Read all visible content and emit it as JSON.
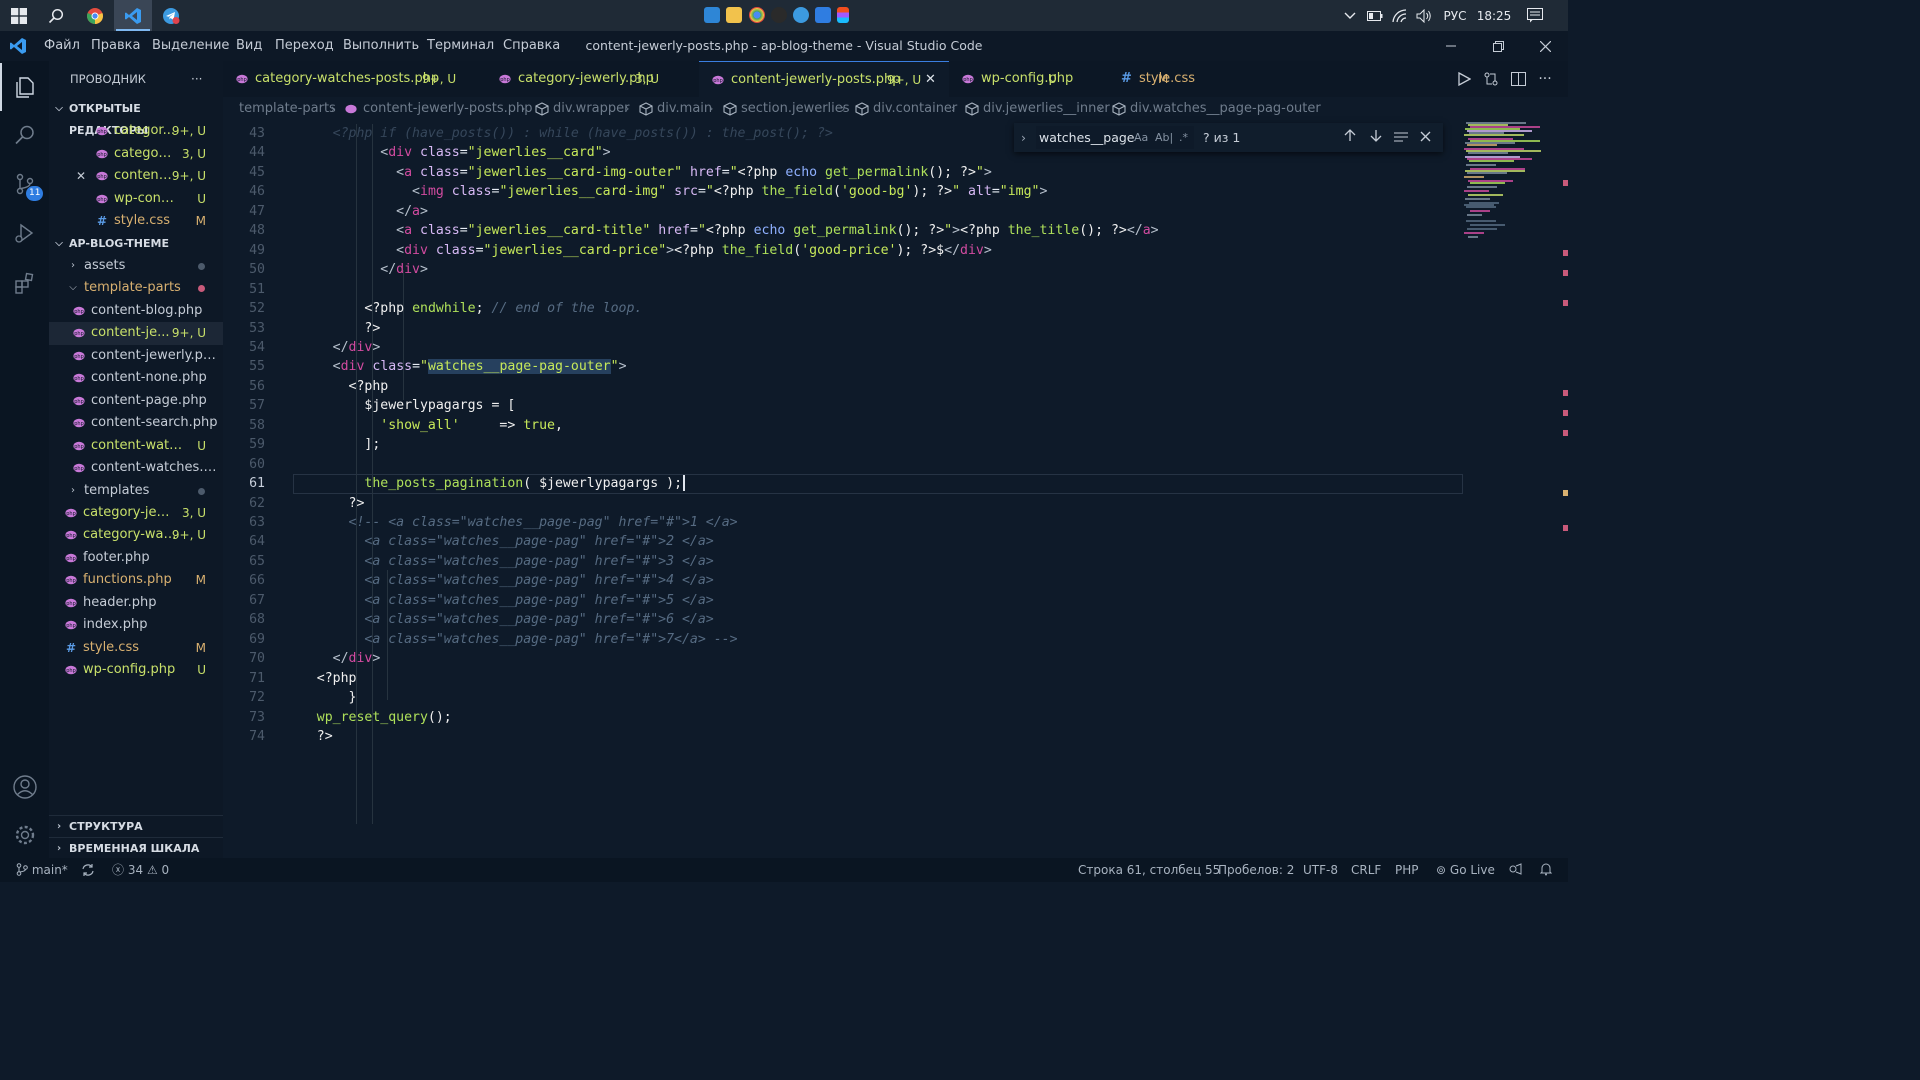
{
  "taskbar": {
    "lang": "РУС",
    "clock": "18:25"
  },
  "titlebar": {
    "menu": [
      "Файл",
      "Правка",
      "Выделение",
      "Вид",
      "Переход",
      "Выполнить",
      "Терминал",
      "Справка"
    ],
    "title": "content-jewerly-posts.php - ap-blog-theme - Visual Studio Code"
  },
  "activity": {
    "scm_badge": "11"
  },
  "sidebar": {
    "header": "ПРОВОДНИК",
    "more": "···",
    "open_editors_title": "ОТКРЫТЫЕ РЕДАКТОРЫ",
    "open_editors": [
      {
        "name": "categor...",
        "badge": "9+, U",
        "type": "php",
        "close": ""
      },
      {
        "name": "category...",
        "badge": "3, U",
        "type": "php",
        "close": ""
      },
      {
        "name": "content...",
        "badge": "9+, U",
        "type": "php",
        "close": "✕"
      },
      {
        "name": "wp-config....",
        "badge": "U",
        "type": "php",
        "close": ""
      },
      {
        "name": "style.css",
        "badge": "M",
        "type": "css",
        "close": ""
      }
    ],
    "project_title": "AP-BLOG-THEME",
    "files": [
      {
        "name": "assets",
        "badge": "",
        "kind": "folder-closed",
        "depth": 1
      },
      {
        "name": "template-parts",
        "badge": "",
        "kind": "folder-open",
        "depth": 1
      },
      {
        "name": "content-blog.php",
        "badge": "",
        "kind": "php",
        "depth": 2
      },
      {
        "name": "content-je...",
        "badge": "9+, U",
        "kind": "php",
        "depth": 2
      },
      {
        "name": "content-jewerly.php",
        "badge": "",
        "kind": "php",
        "depth": 2
      },
      {
        "name": "content-none.php",
        "badge": "",
        "kind": "php",
        "depth": 2
      },
      {
        "name": "content-page.php",
        "badge": "",
        "kind": "php",
        "depth": 2
      },
      {
        "name": "content-search.php",
        "badge": "",
        "kind": "php",
        "depth": 2
      },
      {
        "name": "content-watch...",
        "badge": "U",
        "kind": "php",
        "depth": 2
      },
      {
        "name": "content-watches.php",
        "badge": "",
        "kind": "php",
        "depth": 2
      },
      {
        "name": "templates",
        "badge": "",
        "kind": "folder-closed",
        "depth": 1
      },
      {
        "name": "category-jewe...",
        "badge": "3, U",
        "kind": "php",
        "depth": 0
      },
      {
        "name": "category-wat...",
        "badge": "9+, U",
        "kind": "php",
        "depth": 0
      },
      {
        "name": "footer.php",
        "badge": "",
        "kind": "php",
        "depth": 0
      },
      {
        "name": "functions.php",
        "badge": "M",
        "kind": "php",
        "depth": 0
      },
      {
        "name": "header.php",
        "badge": "",
        "kind": "php",
        "depth": 0
      },
      {
        "name": "index.php",
        "badge": "",
        "kind": "php",
        "depth": 0
      },
      {
        "name": "style.css",
        "badge": "M",
        "kind": "css",
        "depth": 0
      },
      {
        "name": "wp-config.php",
        "badge": "U",
        "kind": "php",
        "depth": 0
      }
    ],
    "outline_title": "СТРУКТУРА",
    "timeline_title": "ВРЕМЕННАЯ ШКАЛА"
  },
  "tabs": [
    {
      "name": "category-watches-posts.php",
      "badge": "9+, U",
      "type": "php"
    },
    {
      "name": "category-jewerly.php",
      "badge": "3, U",
      "type": "php"
    },
    {
      "name": "content-jewerly-posts.php",
      "badge": "9+, U",
      "type": "php"
    },
    {
      "name": "wp-config.php",
      "badge": "U",
      "type": "php"
    },
    {
      "name": "style.css",
      "badge": "M",
      "type": "css"
    }
  ],
  "breadcrumb": [
    "template-parts",
    "content-jewerly-posts.php",
    "div.wrapper",
    "div.main",
    "section.jewerlies",
    "div.container",
    "div.jewerlies__inner",
    "div.watches__page-pag-outer"
  ],
  "find": {
    "query": "watches__page-",
    "aa": "Aa",
    "ab": "Ab|",
    "regex": ".*",
    "result": "? из 1"
  },
  "editor": {
    "line_numbers": [
      "43",
      "44",
      "45",
      "46",
      "47",
      "48",
      "49",
      "50",
      "51",
      "52",
      "53",
      "54",
      "55",
      "56",
      "57",
      "58",
      "59",
      "60",
      "61",
      "62",
      "63",
      "64",
      "65",
      "66",
      "67",
      "68",
      "69",
      "70",
      "71",
      "72",
      "73",
      "74"
    ],
    "current_line": "61"
  },
  "statusbar": {
    "branch": "main*",
    "errors": "34",
    "warnings": "0",
    "position": "Строка 61, столбец 55",
    "spaces": "Пробелов: 2",
    "encoding": "UTF-8",
    "eol": "CRLF",
    "language": "PHP",
    "golive": "Go Live"
  },
  "colors": {
    "accent": "#3a7ee0",
    "php_icon": "#c878d8",
    "css_icon": "#5a9be6",
    "untracked": "#c8e06a",
    "modified": "#d8b070",
    "error_dot": "#c85a7a"
  }
}
